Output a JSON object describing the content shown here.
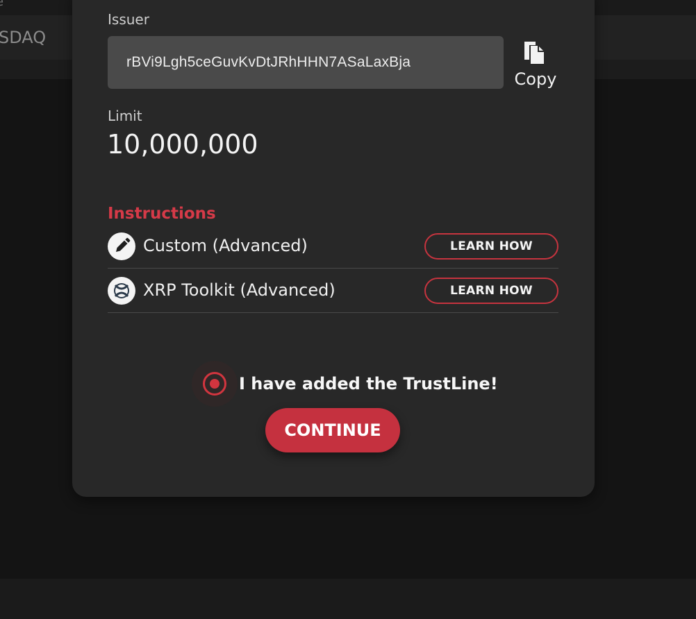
{
  "background": {
    "top_text": "e",
    "row_text": "SDAQ"
  },
  "modal": {
    "issuer": {
      "label": "Issuer",
      "value": "rBVi9Lgh5ceGuvKvDtJRhHHN7ASaLaxBja",
      "copy_label": "Copy"
    },
    "limit": {
      "label": "Limit",
      "value": "10,000,000"
    },
    "instructions": {
      "heading": "Instructions",
      "items": [
        {
          "label": "Custom (Advanced)",
          "icon": "pencil-icon",
          "button": "LEARN HOW"
        },
        {
          "label": "XRP Toolkit (Advanced)",
          "icon": "xrp-toolkit-icon",
          "button": "LEARN HOW"
        }
      ]
    },
    "confirm_label": "I have added the TrustLine!",
    "continue_label": "CONTINUE"
  },
  "colors": {
    "accent": "#c5313f",
    "heading_red": "#d63a48",
    "modal_bg": "#282828",
    "input_bg": "#4a4a4a"
  }
}
